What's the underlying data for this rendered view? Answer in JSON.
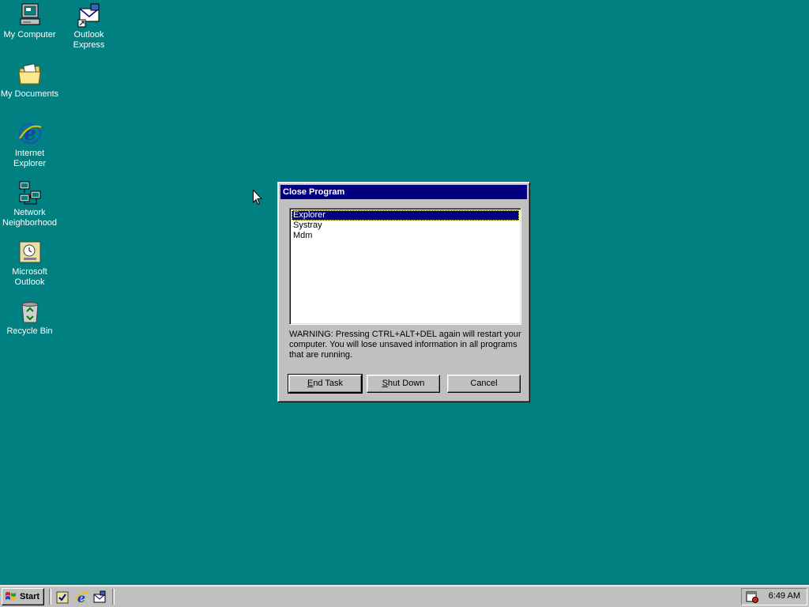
{
  "desktop": {
    "icons": [
      {
        "label": "My Computer",
        "icon": "my-computer-icon"
      },
      {
        "label": "Outlook Express",
        "icon": "outlook-express-icon"
      },
      {
        "label": "My Documents",
        "icon": "my-documents-icon"
      },
      {
        "label": "Internet Explorer",
        "icon": "internet-explorer-icon"
      },
      {
        "label": "Network Neighborhood",
        "icon": "network-neighborhood-icon"
      },
      {
        "label": "Microsoft Outlook",
        "icon": "microsoft-outlook-icon"
      },
      {
        "label": "Recycle Bin",
        "icon": "recycle-bin-icon"
      }
    ],
    "background_color": "#008080"
  },
  "dialog": {
    "title": "Close Program",
    "tasks": [
      "Explorer",
      "Systray",
      "Mdm"
    ],
    "selected_task": "Explorer",
    "warning": "WARNING: Pressing CTRL+ALT+DEL again will restart your computer. You will lose unsaved information in all programs that are running.",
    "buttons": {
      "end_task": {
        "label": "End Task",
        "accel": "E",
        "rest": "nd Task"
      },
      "shut_down": {
        "label": "Shut Down",
        "accel": "S",
        "rest": "hut Down"
      },
      "cancel": {
        "label": "Cancel"
      }
    },
    "title_color": "#000080"
  },
  "taskbar": {
    "start_label": "Start",
    "clock": "6:49 AM",
    "quick_launch": [
      "outlook-icon",
      "internet-explorer-icon",
      "outlook-express-icon"
    ]
  }
}
